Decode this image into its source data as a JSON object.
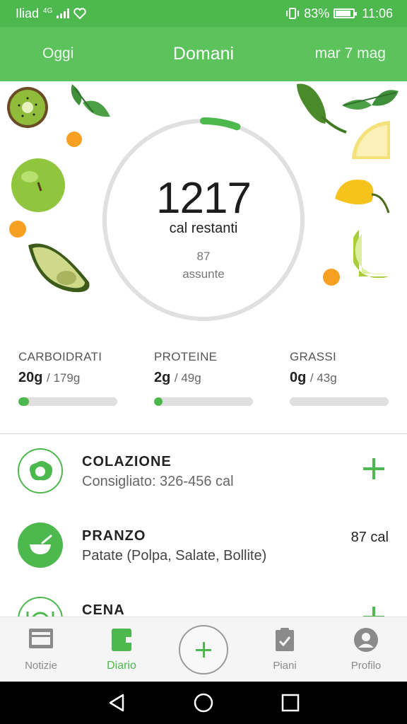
{
  "status_bar": {
    "carrier": "Iliad",
    "network": "4G",
    "battery_percent": "83%",
    "time": "11:06"
  },
  "header": {
    "prev_day": "Oggi",
    "current_day": "Domani",
    "next_day": "mar 7 mag"
  },
  "summary": {
    "calories_remaining": "1217",
    "calories_remaining_label": "cal restanti",
    "calories_consumed": "87",
    "calories_consumed_label": "assunte",
    "progress_fraction": 0.067
  },
  "macros": [
    {
      "name": "CARBOIDRATI",
      "amount": "20g",
      "total": "/ 179g",
      "fraction": 0.11
    },
    {
      "name": "PROTEINE",
      "amount": "2g",
      "total": "/ 49g",
      "fraction": 0.04
    },
    {
      "name": "GRASSI",
      "amount": "0g",
      "total": "/ 43g",
      "fraction": 0.0
    }
  ],
  "meals": [
    {
      "name": "COLAZIONE",
      "detail": "Consigliato: 326-456 cal",
      "calories": "",
      "icon": "egg-icon"
    },
    {
      "name": "PRANZO",
      "detail": "Patate (Polpa, Salate, Bollite)",
      "calories": "87 cal",
      "icon": "bowl-icon"
    },
    {
      "name": "CENA",
      "detail": "",
      "calories": "",
      "icon": "plate-icon"
    }
  ],
  "bottom_nav": {
    "news": "Notizie",
    "diary": "Diario",
    "plans": "Piani",
    "profile": "Profilo"
  },
  "colors": {
    "brand_green": "#5bc25c",
    "status_green": "#4db84e",
    "track_gray": "#e0e0e0"
  }
}
